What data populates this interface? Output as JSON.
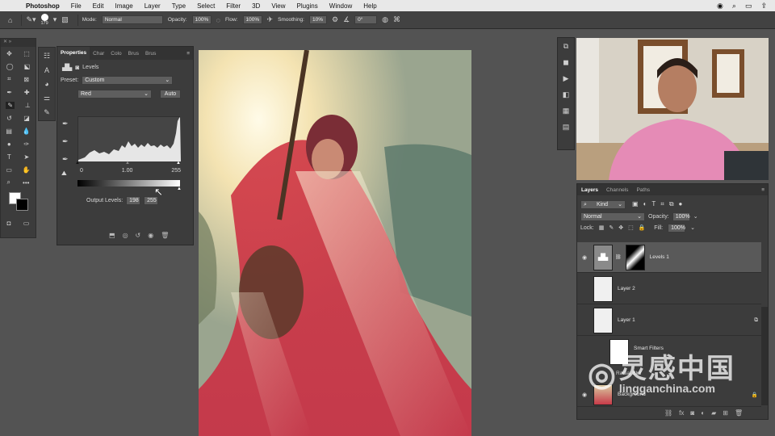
{
  "menubar": {
    "app_name": "Photoshop",
    "items": [
      "File",
      "Edit",
      "Image",
      "Layer",
      "Type",
      "Select",
      "Filter",
      "3D",
      "View",
      "Plugins",
      "Window",
      "Help"
    ]
  },
  "options": {
    "brush_size": "179",
    "mode_label": "Mode:",
    "mode_value": "Normal",
    "opacity_label": "Opacity:",
    "opacity_value": "100%",
    "flow_label": "Flow:",
    "flow_value": "100%",
    "smoothing_label": "Smoothing:",
    "smoothing_value": "10%",
    "angle_value": "0°"
  },
  "properties": {
    "tabs": [
      "Properties",
      "Char",
      "Colo",
      "Brus",
      "Brus"
    ],
    "panel_title": "Levels",
    "preset_label": "Preset:",
    "preset_value": "Custom",
    "channel_value": "Red",
    "auto_label": "Auto",
    "input_black": "0",
    "input_gamma": "1.00",
    "input_white": "255",
    "output_label": "Output Levels:",
    "output_black": "198",
    "output_white": "255"
  },
  "layers": {
    "tabs": [
      "Layers",
      "Channels",
      "Paths"
    ],
    "kind_label": "Kind",
    "blend_mode": "Normal",
    "opacity_label": "Opacity:",
    "opacity_value": "100%",
    "lock_label": "Lock:",
    "fill_label": "Fill:",
    "fill_value": "100%",
    "rows": [
      {
        "name": "Levels 1"
      },
      {
        "name": "Layer 2"
      },
      {
        "name": "Layer 1"
      },
      {
        "name": "Smart Filters"
      },
      {
        "name": "Radial Blur"
      },
      {
        "name": "Background"
      }
    ]
  },
  "watermark": {
    "cn_text": "灵感中国",
    "url_text": "lingganchina.com"
  }
}
